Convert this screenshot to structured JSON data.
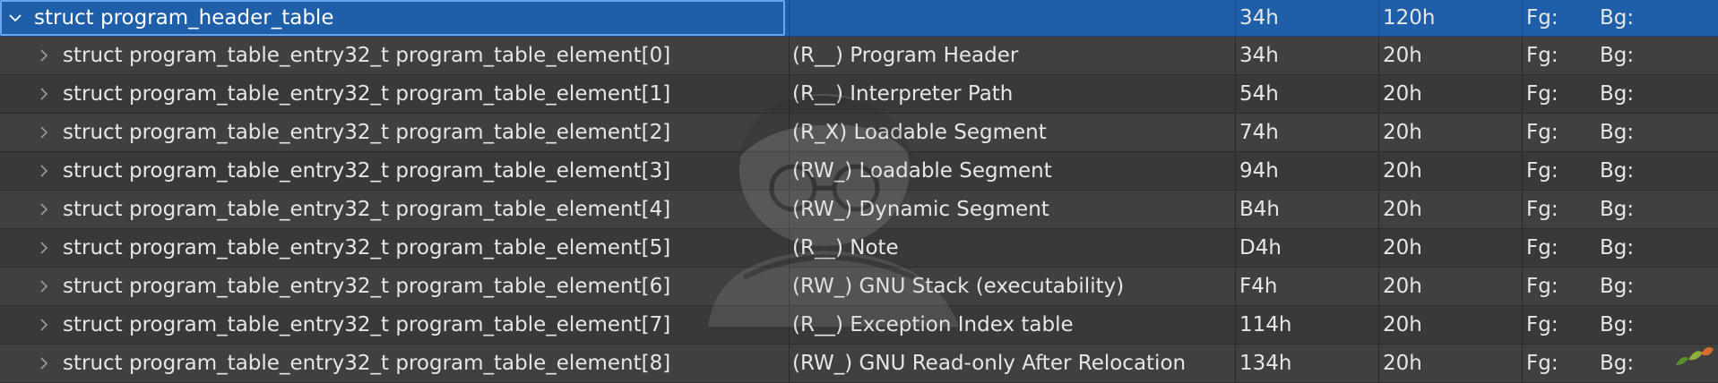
{
  "root": {
    "name": "struct program_header_table",
    "comment": "",
    "start": "34h",
    "size": "120h",
    "fg_label": "Fg:",
    "bg_label": "Bg:"
  },
  "rows": [
    {
      "name": "struct program_table_entry32_t program_table_element[0]",
      "comment": "(R__) Program Header",
      "start": "34h",
      "size": "20h",
      "fg_label": "Fg:",
      "bg_label": "Bg:"
    },
    {
      "name": "struct program_table_entry32_t program_table_element[1]",
      "comment": "(R__) Interpreter Path",
      "start": "54h",
      "size": "20h",
      "fg_label": "Fg:",
      "bg_label": "Bg:"
    },
    {
      "name": "struct program_table_entry32_t program_table_element[2]",
      "comment": "(R_X) Loadable Segment",
      "start": "74h",
      "size": "20h",
      "fg_label": "Fg:",
      "bg_label": "Bg:"
    },
    {
      "name": "struct program_table_entry32_t program_table_element[3]",
      "comment": "(RW_) Loadable Segment",
      "start": "94h",
      "size": "20h",
      "fg_label": "Fg:",
      "bg_label": "Bg:"
    },
    {
      "name": "struct program_table_entry32_t program_table_element[4]",
      "comment": "(RW_) Dynamic Segment",
      "start": "B4h",
      "size": "20h",
      "fg_label": "Fg:",
      "bg_label": "Bg:"
    },
    {
      "name": "struct program_table_entry32_t program_table_element[5]",
      "comment": "(R__) Note",
      "start": "D4h",
      "size": "20h",
      "fg_label": "Fg:",
      "bg_label": "Bg:"
    },
    {
      "name": "struct program_table_entry32_t program_table_element[6]",
      "comment": "(RW_) GNU Stack (executability)",
      "start": "F4h",
      "size": "20h",
      "fg_label": "Fg:",
      "bg_label": "Bg:"
    },
    {
      "name": "struct program_table_entry32_t program_table_element[7]",
      "comment": "(R__) Exception Index table",
      "start": "114h",
      "size": "20h",
      "fg_label": "Fg:",
      "bg_label": "Bg:"
    },
    {
      "name": "struct program_table_entry32_t program_table_element[8]",
      "comment": "(RW_) GNU Read-only After Relocation",
      "start": "134h",
      "size": "20h",
      "fg_label": "Fg:",
      "bg_label": "Bg:"
    }
  ],
  "icons": {
    "root_toggle": "chevron-down-icon",
    "child_toggle": "chevron-right-icon"
  },
  "colors": {
    "selection": "#1f5fa9",
    "row_bg": "#3c3c3c",
    "text": "#e6e6e6"
  }
}
